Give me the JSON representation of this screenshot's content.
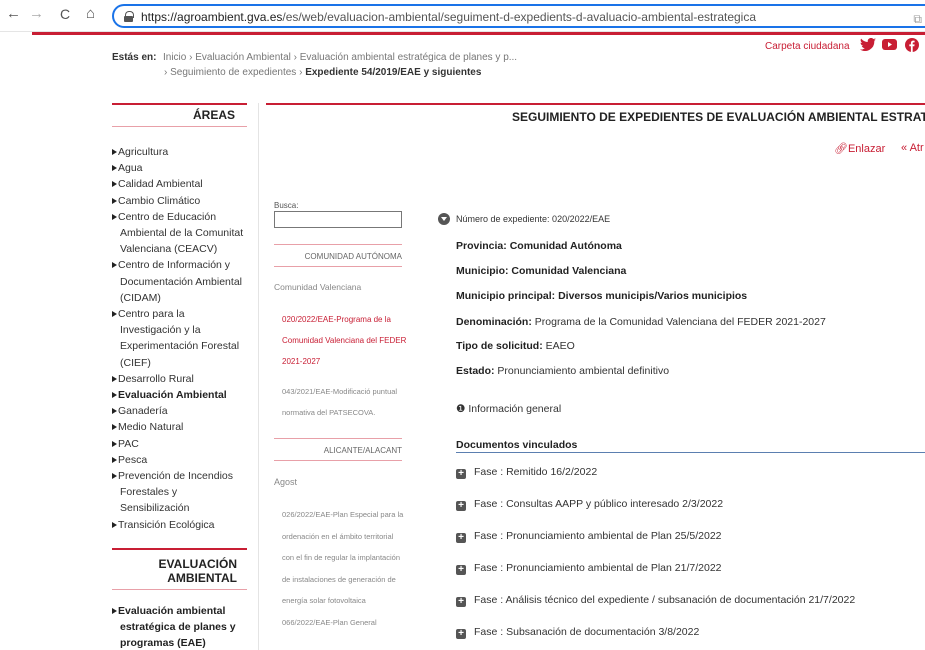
{
  "browser": {
    "back": "←",
    "forward": "→",
    "reload": "C",
    "home": "⌂",
    "url_host": "https://agroambient.gva.es",
    "url_path": "/es/web/evaluacion-ambiental/seguiment-d-expedients-d-avaluacio-ambiental-estrategica"
  },
  "breadcrumb": {
    "prefix": "Estás en:",
    "line1": "Inicio › Evaluación Ambiental › Evaluación ambiental estratégica de planes y p...",
    "line2_a": "› Seguimiento de expedientes ›",
    "line2_b": "Expediente 54/2019/EAE y siguientes"
  },
  "header": {
    "carpeta": "Carpeta ciudadana",
    "social_icons": [
      "twitter-icon",
      "youtube-icon",
      "facebook-icon"
    ]
  },
  "sidebar": {
    "areas_title": "ÁREAS",
    "items": [
      {
        "label": "Agricultura"
      },
      {
        "label": "Agua"
      },
      {
        "label": "Calidad Ambiental"
      },
      {
        "label": "Cambio Climático"
      },
      {
        "label": "Centro de Educación",
        "cont": [
          "Ambiental de la Comunitat",
          "Valenciana (CEACV)"
        ]
      },
      {
        "label": "Centro de Información y",
        "cont": [
          "Documentación Ambiental",
          "(CIDAM)"
        ]
      },
      {
        "label": "Centro para la",
        "cont": [
          "Investigación y la",
          "Experimentación Forestal",
          "(CIEF)"
        ]
      },
      {
        "label": "Desarrollo Rural"
      },
      {
        "label": "Evaluación Ambiental",
        "bold": true
      },
      {
        "label": "Ganadería"
      },
      {
        "label": "Medio Natural"
      },
      {
        "label": "PAC"
      },
      {
        "label": "Pesca"
      },
      {
        "label": "Prevención de Incendios",
        "cont": [
          "Forestales y",
          "Sensibilización"
        ]
      },
      {
        "label": "Transición Ecológica"
      }
    ],
    "eval_title_1": "EVALUACIÓN",
    "eval_title_2": "AMBIENTAL",
    "eval_item_1": "Evaluación ambiental",
    "eval_item_2": "estratégica de planes y",
    "eval_item_3": "programas (EAE)"
  },
  "main": {
    "title": "SEGUIMIENTO DE EXPEDIENTES DE EVALUACIÓN AMBIENTAL ESTRATÉGICA",
    "enlazar": "Enlazar",
    "atras": "« Atr",
    "expediente_label": "Número de expediente: 020/2022/EAE",
    "fields": [
      {
        "label": "Provincia:",
        "value": "Comunidad Autónoma",
        "bold_value": true
      },
      {
        "label": "Municipio:",
        "value": "Comunidad Valenciana",
        "bold_value": true
      },
      {
        "label": "Municipio principal:",
        "value": "Diversos municipis/Varios municipios",
        "bold_value": true
      },
      {
        "label": "Denominación:",
        "value": "Programa de la Comunidad Valenciana del FEDER 2021-2027",
        "bold_value": false
      },
      {
        "label": "Tipo de solicitud:",
        "value": "EAEO",
        "bold_value": false
      },
      {
        "label": "Estado:",
        "value": "Pronunciamiento ambiental definitivo",
        "bold_value": false
      }
    ],
    "info": "Información general",
    "docs_title": "Documentos vinculados",
    "fases": [
      "Fase : Remitido 16/2/2022",
      "Fase : Consultas AAPP y público interesado 2/3/2022",
      "Fase : Pronunciamiento ambiental de Plan 25/5/2022",
      "Fase : Pronunciamiento ambiental de Plan 21/7/2022",
      "Fase : Análisis técnico del expediente / subsanación de documentación 21/7/2022",
      "Fase : Subsanación de documentación 3/8/2022"
    ]
  },
  "middle": {
    "busca": "Busca:",
    "comunidad_head": "COMUNIDAD AUTÓNOMA",
    "comunidad_sub": "Comunidad Valenciana",
    "red_lines": [
      "020/2022/EAE-Programa de la",
      "Comunidad Valenciana del FEDER",
      "2021-2027"
    ],
    "grey_lines_1": [
      "043/2021/EAE-Modificació puntual",
      "normativa del PATSECOVA."
    ],
    "alicante_head": "ALICANTE/ALACANT",
    "agost": "Agost",
    "grey_lines_2": [
      "026/2022/EAE-Plan Especial para la",
      "ordenación en el ámbito territorial",
      "con el fin de regular la implantación",
      "de instalaciones de generación de",
      "energía solar fotovoltaica",
      "066/2022/EAE-Plan General"
    ]
  }
}
